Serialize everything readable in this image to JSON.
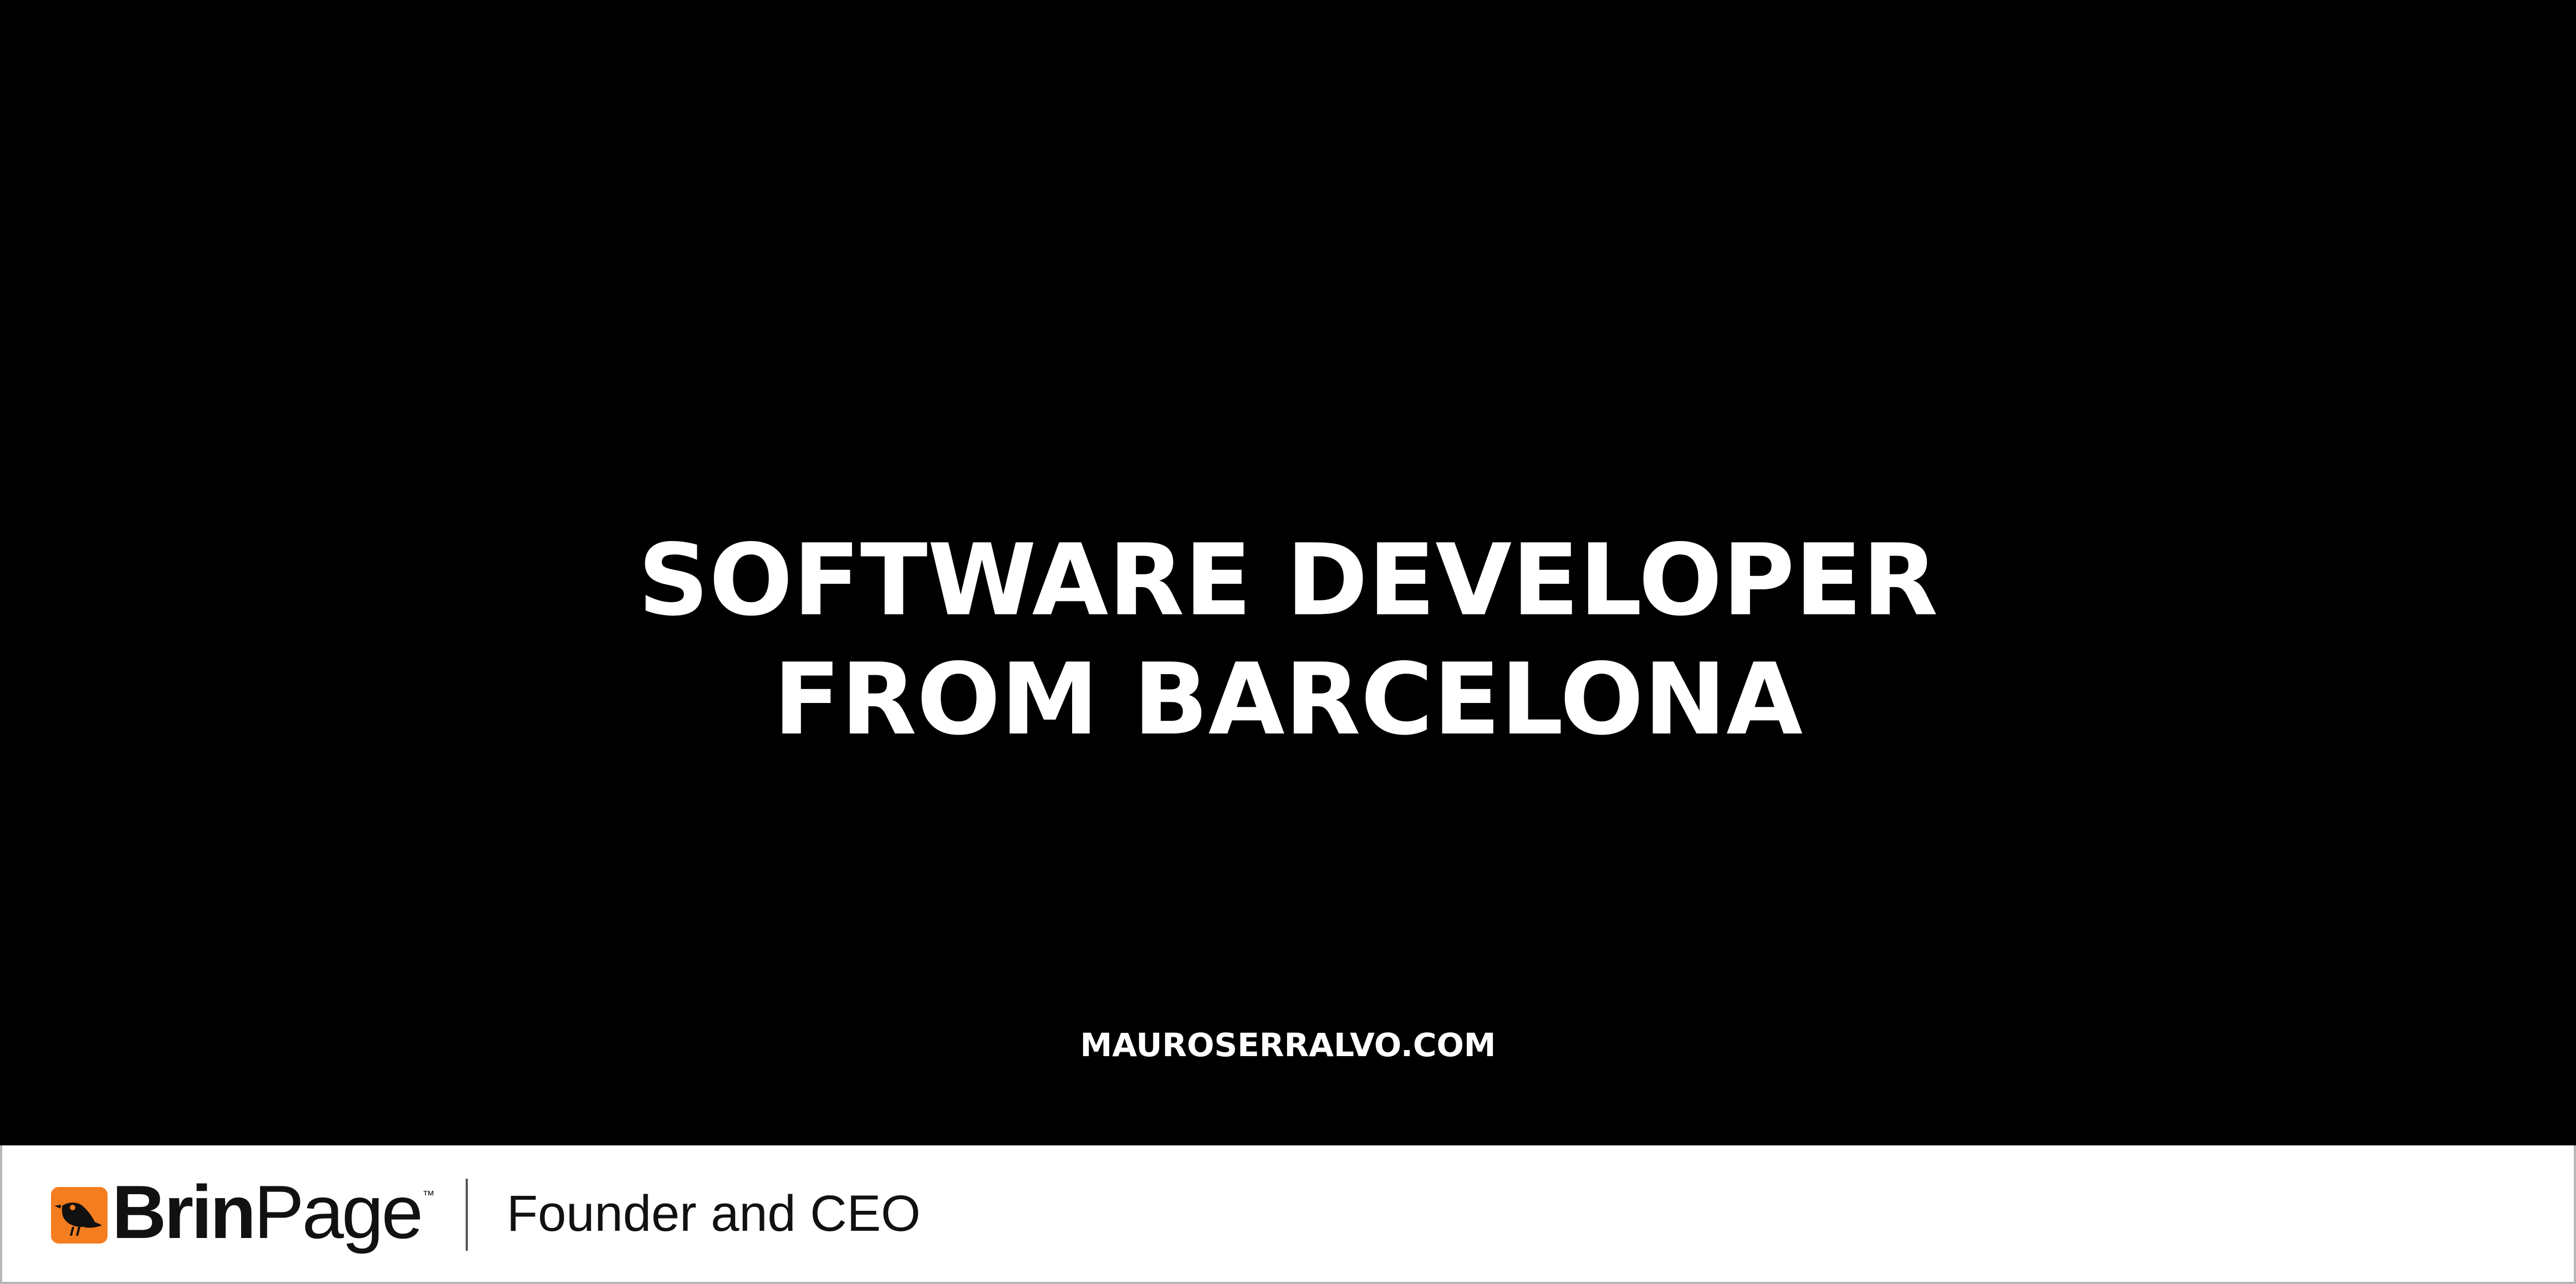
{
  "hero": {
    "headline_line_1": "SOFTWARE DEVELOPER",
    "headline_line_2": "FROM BARCELONA",
    "website": "MAUROSERRALVO.COM"
  },
  "footer": {
    "brand_part_1": "Brin",
    "brand_part_2": "Page",
    "trademark": "™",
    "role": "Founder and CEO",
    "logo_icon": "bird-icon"
  },
  "colors": {
    "background": "#000000",
    "footer_background": "#ffffff",
    "accent": "#f47d20",
    "text_light": "#ffffff",
    "text_dark": "#111111"
  }
}
